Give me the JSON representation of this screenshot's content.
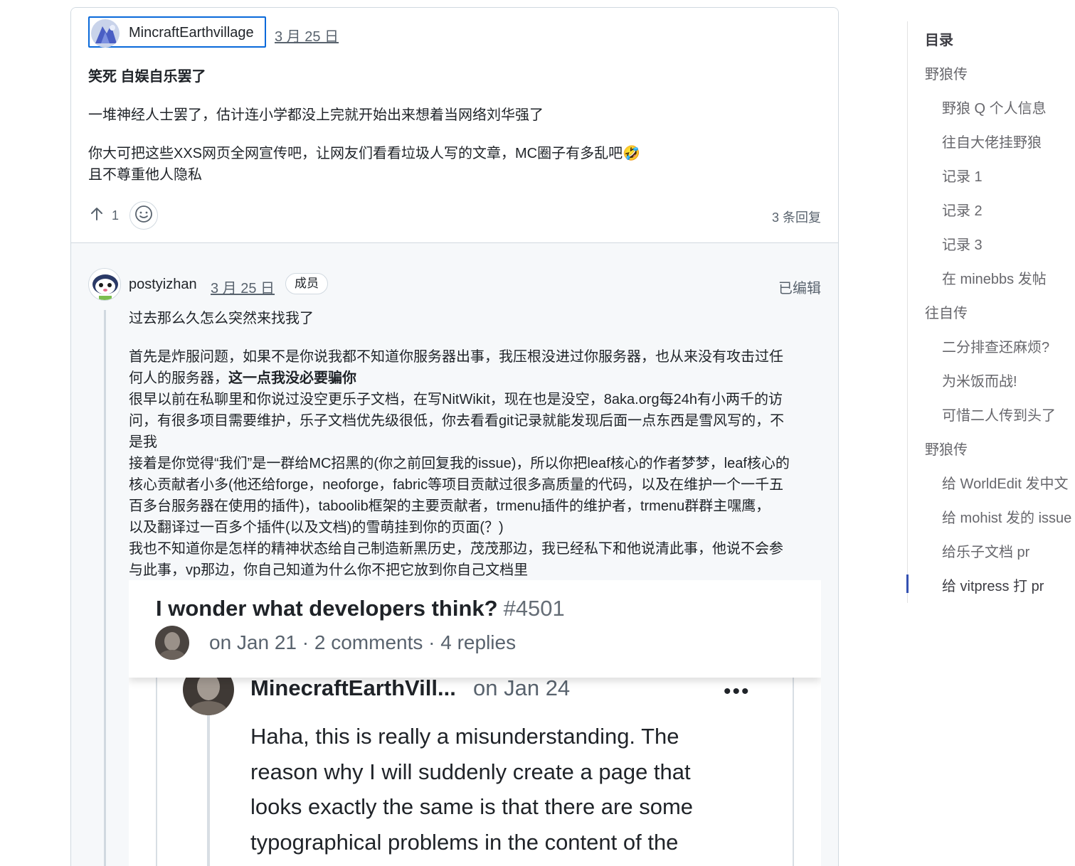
{
  "top_comment": {
    "author": "MincraftEarthvillage",
    "date": "3 月 25 日",
    "title": "笑死 自娱自乐罢了",
    "para1": "一堆神经人士罢了，估计连小学都没上完就开始出来想着当网络刘华强了",
    "para2_line1": "你大可把这些XXS网页全网宣传吧，让网友们看看垃圾人写的文章，MC圈子有多乱吧🤣",
    "para2_line2": "且不尊重他人隐私",
    "upvote_count": "1",
    "reply_count": "3 条回复"
  },
  "reply": {
    "author": "postyizhan",
    "date": "3 月 25 日",
    "badge": "成员",
    "edited": "已编辑",
    "line1": "过去那么久怎么突然来找我了",
    "p2_l1": "首先是炸服问题，如果不是你说我都不知道你服务器出事，我压根没进过你服务器，也从来没有攻击过任",
    "p2_l2_normal": "何人的服务器，",
    "p2_l2_bold": "这一点我没必要骗你",
    "p3_l1": "很早以前在私聊里和你说过没空更乐子文档，在写NitWikit，现在也是没空，8aka.org每24h有小两千的访",
    "p3_l2": "问，有很多项目需要维护，乐子文档优先级很低，你去看看git记录就能发现后面一点东西是雪风写的，不",
    "p3_l3": "是我",
    "p4_l1": "接着是你觉得“我们”是一群给MC招黑的(你之前回复我的issue)，所以你把leaf核心的作者梦梦，leaf核心的",
    "p4_l2": "核心贡献者小多(他还给forge，neoforge，fabric等项目贡献过很多高质量的代码，以及在维护一个一千五",
    "p4_l3": "百多台服务器在使用的插件)，taboolib框架的主要贡献者，trmenu插件的维护者，trmenu群群主嘿鹰，",
    "p4_l4": "以及翻译过一百多个插件(以及文档)的雪萌挂到你的页面(？)",
    "p5_l1": "我也不知道你是怎样的精神状态给自己制造新黑历史，茂茂那边，我已经私下和他说清此事，他说不会参",
    "p5_l2": "与此事，vp那边，你自己知道为什么你不把它放到你自己文档里"
  },
  "embed": {
    "title": "I wonder what developers think?",
    "number": "#4501",
    "meta": "on Jan 21  ·  2 comments  ·  4 replies",
    "comment_author": "MinecraftEarthVill...",
    "comment_date": "on Jan 24",
    "more": "•••",
    "lines": [
      "Haha, this is really a misunderstanding. The",
      "reason why I will suddenly create a page that",
      "looks exactly the same is that there are some",
      "typographical problems in the content of the"
    ]
  },
  "toc": {
    "title": "目录",
    "items": [
      {
        "label": "野狼传",
        "level": 1
      },
      {
        "label": "野狼 Q 个人信息",
        "level": 2
      },
      {
        "label": "往自大佬挂野狼",
        "level": 2
      },
      {
        "label": "记录 1",
        "level": 2
      },
      {
        "label": "记录 2",
        "level": 2
      },
      {
        "label": "记录 3",
        "level": 2
      },
      {
        "label": "在 minebbs 发帖",
        "level": 2
      },
      {
        "label": "往自传",
        "level": 1
      },
      {
        "label": "二分排查还麻烦?",
        "level": 2
      },
      {
        "label": "为米饭而战!",
        "level": 2
      },
      {
        "label": "可惜二人传到头了",
        "level": 2
      },
      {
        "label": "野狼传",
        "level": 1
      },
      {
        "label": "给 WorldEdit 发中文",
        "level": 2
      },
      {
        "label": "给 mohist 发的 issue",
        "level": 2
      },
      {
        "label": "给乐子文档 pr",
        "level": 2
      },
      {
        "label": "给 vitpress 打 pr",
        "level": 2,
        "active": true
      }
    ]
  },
  "colors": {
    "link_blue": "#0969da",
    "toc_active": "#3451b2",
    "muted": "#59636e",
    "border": "#d1d9e0"
  }
}
